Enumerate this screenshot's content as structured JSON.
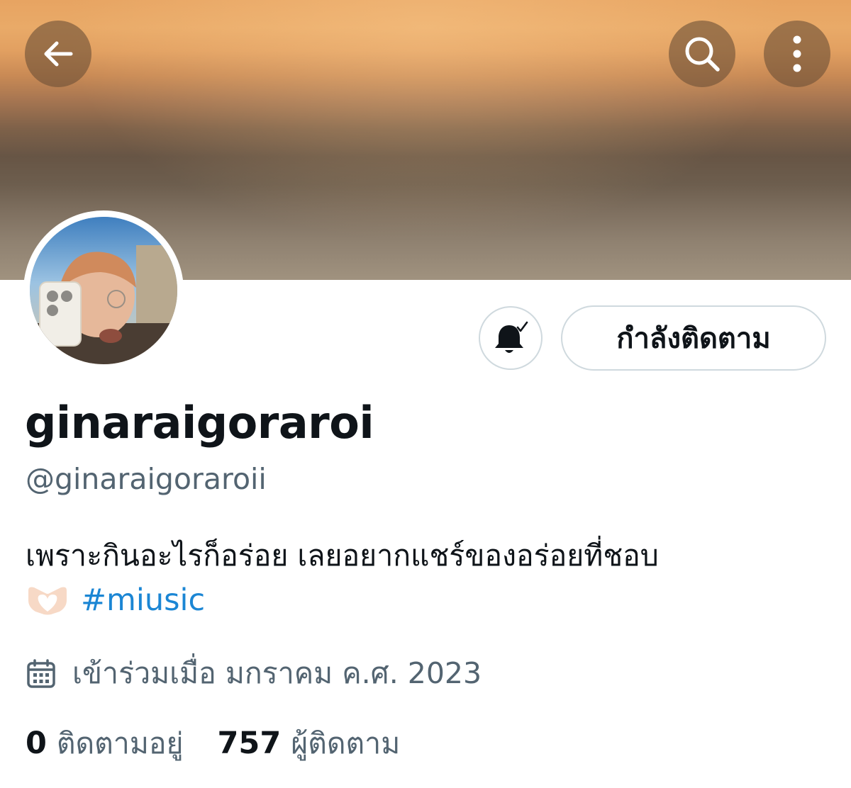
{
  "header": {
    "back_icon": "arrow-left-icon",
    "search_icon": "search-icon",
    "more_icon": "more-vertical-icon"
  },
  "profile": {
    "display_name": "ginaraigoraroi",
    "handle": "@ginaraigoraroii",
    "bio": "เพราะกินอะไรก็อร่อย เลยอยากแชร์ของอร่อยที่ชอบ",
    "bio_emoji": "heart-hands-emoji",
    "hashtag": "#miusic",
    "joined": "เข้าร่วมเมื่อ มกราคม ค.ศ. 2023",
    "following_count": "0",
    "following_label": "ติดตามอยู่",
    "followers_count": "757",
    "followers_label": "ผู้ติดตาม"
  },
  "actions": {
    "notify_icon": "bell-check-icon",
    "follow_label": "กำลังติดตาม"
  },
  "colors": {
    "accent": "#1d9bf0",
    "secondary_text": "#536471",
    "border": "#cfd9de"
  }
}
